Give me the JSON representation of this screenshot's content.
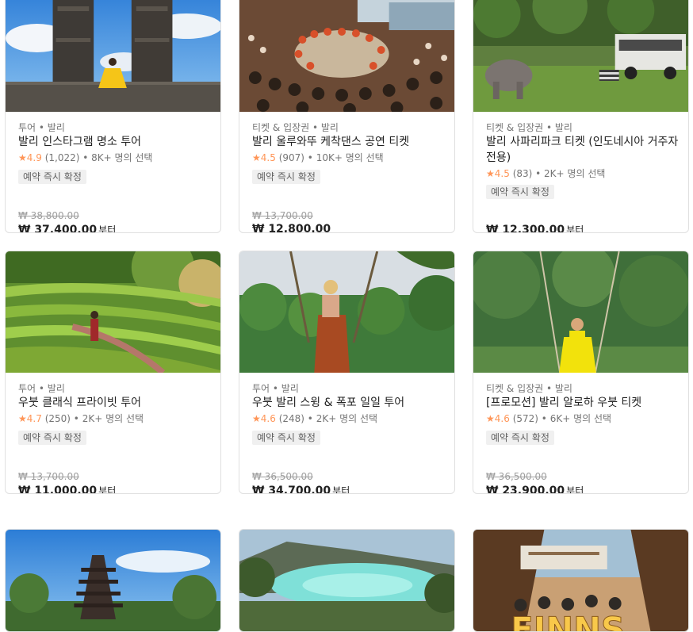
{
  "cards": [
    {
      "category": "투어 • 발리",
      "title": "발리 인스타그램 명소 투어",
      "score": "4.9",
      "reviews": "(1,022)",
      "booked": "• 8K+ 명의 선택",
      "badge": "예약 즉시 확정",
      "original_price": "₩ 38,800.00",
      "price": "₩ 37,400.00",
      "price_suffix": "부터",
      "image": "temple-gate-photo"
    },
    {
      "category": "티켓 & 입장권 • 발리",
      "title": "발리 울루와뚜 케착댄스 공연 티켓",
      "score": "4.5",
      "reviews": "(907)",
      "booked": "• 10K+ 명의 선택",
      "badge": "예약 즉시 확정",
      "original_price": "₩ 13,700.00",
      "price": "₩ 12,800.00",
      "price_suffix": "",
      "image": "kecak-dance-photo"
    },
    {
      "category": "티켓 & 입장권 • 발리",
      "title": "발리 사파리파크 티켓 (인도네시아 거주자 전용)",
      "score": "4.5",
      "reviews": "(83)",
      "booked": "• 2K+ 명의 선택",
      "badge": "예약 즉시 확정",
      "original_price": "",
      "price": "₩ 12,300.00",
      "price_suffix": "부터",
      "image": "safari-park-photo"
    },
    {
      "category": "투어 • 발리",
      "title": "우붓 클래식 프라이빗 투어",
      "score": "4.7",
      "reviews": "(250)",
      "booked": "• 2K+ 명의 선택",
      "badge": "예약 즉시 확정",
      "original_price": "₩ 13,700.00",
      "price": "₩ 11,000.00",
      "price_suffix": "부터",
      "image": "rice-terrace-photo"
    },
    {
      "category": "투어 • 발리",
      "title": "우붓 발리 스윙 & 폭포 일일 투어",
      "score": "4.6",
      "reviews": "(248)",
      "booked": "• 2K+ 명의 선택",
      "badge": "예약 즉시 확정",
      "original_price": "₩ 36,500.00",
      "price": "₩ 34,700.00",
      "price_suffix": "부터",
      "image": "jungle-swing-photo"
    },
    {
      "category": "티켓 & 입장권 • 발리",
      "title": "[프로모션] 발리 알로하 우붓 티켓",
      "score": "4.6",
      "reviews": "(572)",
      "booked": "• 6K+ 명의 선택",
      "badge": "예약 즉시 확정",
      "original_price": "₩ 36,500.00",
      "price": "₩ 23,900.00",
      "price_suffix": "부터",
      "image": "aloha-swing-photo"
    },
    {
      "image": "pagoda-temple-photo"
    },
    {
      "image": "volcano-lake-photo"
    },
    {
      "image": "finns-beach-club-photo",
      "sign_text": "FINNS"
    }
  ]
}
